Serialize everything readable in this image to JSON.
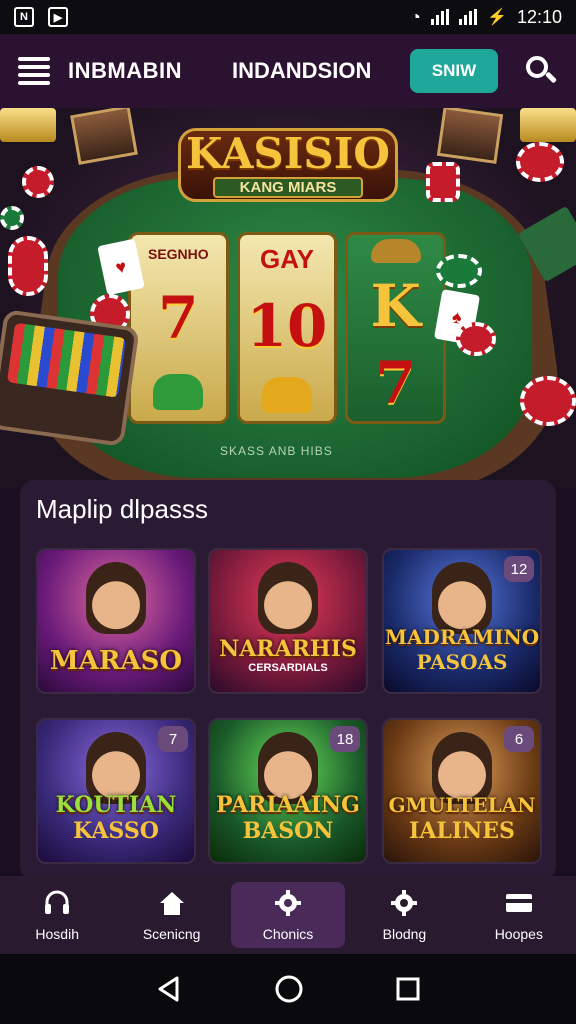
{
  "status_bar": {
    "time": "12:10",
    "left_icons": [
      "notification-n-icon",
      "play-icon"
    ]
  },
  "top_nav": {
    "title_left": "INBMABIN",
    "title_center": "INDANDSION",
    "signin_label": "SNIW",
    "accent": "#1fa89a"
  },
  "hero": {
    "logo_title": "KASISIO",
    "logo_subtitle": "KANG MIARS",
    "reels": [
      {
        "top": "SEGNHO",
        "mid": "7",
        "bottom": ""
      },
      {
        "top": "GAY",
        "mid": "10",
        "bottom": ""
      },
      {
        "top": "",
        "mid": "K",
        "bottom": "7"
      }
    ],
    "table_caption": "SKASS ANB HIBS"
  },
  "panel": {
    "title": "Maplip dlpasss",
    "tiles": [
      {
        "title": "MARASO",
        "subtitle": "",
        "badge": "",
        "bg": "#6a1a7a"
      },
      {
        "title": "NARARHIS",
        "subtitle": "CERSARDIALS",
        "badge": "",
        "bg": "#7a1a3a"
      },
      {
        "title": "MADRAMINO",
        "subtitle": "PASOAS",
        "badge": "12",
        "bg": "#1a2a6a"
      },
      {
        "title": "KOUTIAN",
        "subtitle": "KASSO",
        "badge": "7",
        "bg": "#3a2a7a"
      },
      {
        "title": "PARIAAING",
        "subtitle": "BASON",
        "badge": "18",
        "bg": "#1a5a2a"
      },
      {
        "title": "GMULTELAN",
        "subtitle": "IALINES",
        "badge": "6",
        "bg": "#6a3a14"
      }
    ]
  },
  "bottom_nav": {
    "items": [
      {
        "label": "Hosdih",
        "icon": "headset-icon"
      },
      {
        "label": "Scenicng",
        "icon": "home-icon"
      },
      {
        "label": "Chonics",
        "icon": "gear-icon"
      },
      {
        "label": "Blodng",
        "icon": "settings-icon"
      },
      {
        "label": "Hoopes",
        "icon": "wallet-icon"
      }
    ],
    "active_index": 2
  }
}
